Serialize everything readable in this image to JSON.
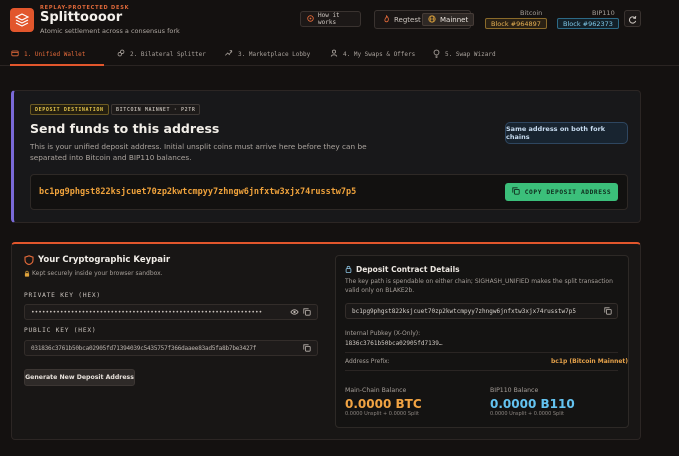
{
  "header": {
    "eyebrow": "REPLAY-PROTECTED DESK",
    "brand": "Splittoooor",
    "tagline": "Atomic settlement across a consensus fork",
    "how_it_works": "How it works",
    "network": {
      "regtest": "Regtest",
      "mainnet": "Mainnet",
      "selected": "Mainnet"
    },
    "chains": [
      {
        "name": "Bitcoin",
        "block": "Block #964897",
        "color": "#e6b154"
      },
      {
        "name": "BIP110",
        "block": "Block #962373",
        "color": "#7fc9ea"
      }
    ],
    "icons": {
      "logo": "stack-icon",
      "how": "lightbulb-icon",
      "regtest": "flame-icon",
      "mainnet": "globe-icon",
      "refresh": "refresh-icon"
    }
  },
  "tabs": [
    {
      "label": "1. Unified Wallet",
      "icon": "wallet-icon",
      "active": true
    },
    {
      "label": "2. Bilateral Splitter",
      "icon": "link-icon",
      "active": false
    },
    {
      "label": "3. Marketplace Lobby",
      "icon": "trend-icon",
      "active": false
    },
    {
      "label": "4. My Swaps & Offers",
      "icon": "user-icon",
      "active": false
    },
    {
      "label": "5. Swap Wizard",
      "icon": "bulb-icon",
      "active": false
    }
  ],
  "deposit": {
    "pill_destination": "DEPOSIT DESTINATION",
    "pill_network": "BITCOIN MAINNET · P2TR",
    "title": "Send funds to this address",
    "description": "This is your unified deposit address. Initial unsplit coins must arrive here before they can be separated into Bitcoin and BIP110 balances.",
    "same_address": "Same address on both fork chains",
    "address": "bc1pg9phgst822ksjcuet70zp2kwtcmpyy7zhngw6jnfxtw3xjx74russtw7p5",
    "copy_label": "COPY DEPOSIT ADDRESS"
  },
  "keypair": {
    "title": "Your Cryptographic Keypair",
    "subtitle": "Kept securely inside your browser sandbox.",
    "private_label": "PRIVATE KEY (HEX)",
    "private_value": "••••••••••••••••••••••••••••••••••••••••••••••••••••••••••••••••",
    "public_label": "PUBLIC KEY (HEX)",
    "public_value": "031836c3761b50bca02905fd71394039c5435757f366daaee83ad5fa8b7be3427f",
    "generate_label": "Generate New Deposit Address"
  },
  "contract": {
    "title": "Deposit Contract Details",
    "description": "The key path is spendable on either chain; SIGHASH_UNIFIED makes the split transaction valid only on BLAKE2b.",
    "address": "bc1pg9phgst822ksjcuet70zp2kwtcmpyy7zhngw6jnfxtw3xjx74russtw7p5",
    "internal_pubkey_label": "Internal Pubkey (X-Only):",
    "internal_pubkey_value": "1836c3761b50bca02905fd7139…",
    "prefix_label": "Address Prefix:",
    "prefix_value": "bc1p (Bitcoin Mainnet)",
    "main_balance_label": "Main-Chain Balance",
    "main_balance_value": "0.0000 BTC",
    "main_balance_sub": "0.0000 Unsplit + 0.0000 Split",
    "bip_balance_label": "BIP110 Balance",
    "bip_balance_value": "0.0000 B110",
    "bip_balance_sub": "0.0000 Unsplit + 0.0000 Split"
  }
}
